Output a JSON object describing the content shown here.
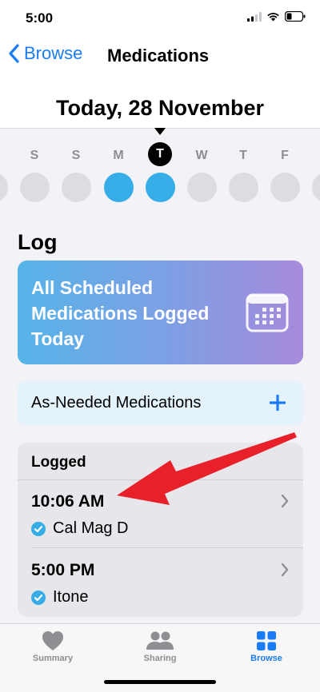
{
  "status_bar": {
    "time": "5:00"
  },
  "nav": {
    "back_label": "Browse",
    "title": "Medications"
  },
  "date_header": {
    "title": "Today, 28 November"
  },
  "week": {
    "days": [
      {
        "letter": "S",
        "logged": false
      },
      {
        "letter": "S",
        "logged": false
      },
      {
        "letter": "M",
        "logged": true
      },
      {
        "letter": "T",
        "logged": true,
        "today": true
      },
      {
        "letter": "W",
        "logged": false
      },
      {
        "letter": "T",
        "logged": false
      },
      {
        "letter": "F",
        "logged": false
      }
    ]
  },
  "log": {
    "section_title": "Log",
    "scheduled_card": {
      "text": "All Scheduled Medications Logged Today"
    },
    "as_needed": {
      "label": "As-Needed Medications"
    },
    "logged": {
      "header": "Logged",
      "entries": [
        {
          "time": "10:06 AM",
          "medication": "Cal Mag D"
        },
        {
          "time": "5:00 PM",
          "medication": "Itone"
        }
      ]
    }
  },
  "colors": {
    "accent": "#1a7cf5",
    "logged_dot": "#36ade7",
    "arrow": "#e8202a"
  },
  "tab_bar": {
    "tabs": [
      {
        "label": "Summary",
        "icon": "heart-icon",
        "active": false
      },
      {
        "label": "Sharing",
        "icon": "people-icon",
        "active": false
      },
      {
        "label": "Browse",
        "icon": "grid-icon",
        "active": true
      }
    ]
  }
}
